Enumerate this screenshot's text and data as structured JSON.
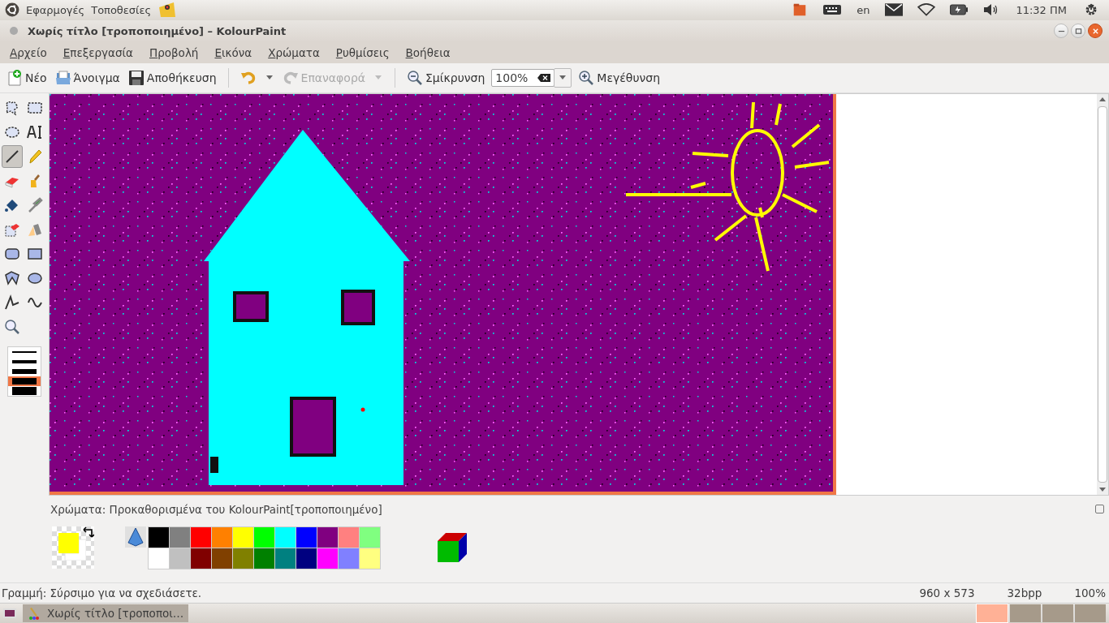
{
  "top_panel": {
    "menus": [
      "Εφαρμογές",
      "Τοποθεσίες"
    ],
    "indicators": [
      {
        "kind": "folder"
      },
      {
        "kind": "keyboard"
      },
      {
        "kind": "text",
        "label": "en"
      },
      {
        "kind": "mail"
      },
      {
        "kind": "wifi"
      },
      {
        "kind": "battery"
      },
      {
        "kind": "volume"
      },
      {
        "kind": "text",
        "label": "11:32 ΠΜ"
      },
      {
        "kind": "power"
      }
    ]
  },
  "window": {
    "title": "Χωρίς τίτλο [τροποποιημένο] – KolourPaint"
  },
  "menu_bar": [
    "Αρχείο",
    "Επεξεργασία",
    "Προβολή",
    "Εικόνα",
    "Χρώματα",
    "Ρυθμίσεις",
    "Βοήθεια"
  ],
  "toolbar": [
    {
      "kind": "new",
      "label": "Νέο",
      "disabled": false
    },
    {
      "kind": "open",
      "label": "Άνοιγμα",
      "disabled": false
    },
    {
      "kind": "save",
      "label": "Αποθήκευση",
      "disabled": false
    },
    {
      "kind": "separator"
    },
    {
      "kind": "undo",
      "disabled": false
    },
    {
      "kind": "redo",
      "label": "Επαναφορά",
      "disabled": true
    },
    {
      "kind": "separator"
    },
    {
      "kind": "zoom-out",
      "label": "Σμίκρυνση",
      "disabled": false
    },
    {
      "kind": "zoom-field",
      "value": "100%"
    },
    {
      "kind": "zoom-in",
      "label": "Μεγέθυνση",
      "disabled": false
    }
  ],
  "tools": [
    {
      "kind": "free-select",
      "selected": false
    },
    {
      "kind": "rect-select",
      "selected": false
    },
    {
      "kind": "ellipse-select",
      "selected": false
    },
    {
      "kind": "text",
      "selected": false
    },
    {
      "kind": "line",
      "selected": true
    },
    {
      "kind": "pen",
      "selected": false
    },
    {
      "kind": "eraser",
      "selected": false
    },
    {
      "kind": "brush",
      "selected": false
    },
    {
      "kind": "fill",
      "selected": false
    },
    {
      "kind": "picker",
      "selected": false
    },
    {
      "kind": "color-eraser",
      "selected": false
    },
    {
      "kind": "spraycan",
      "selected": false
    },
    {
      "kind": "rounded-rect",
      "selected": false
    },
    {
      "kind": "rect",
      "selected": false
    },
    {
      "kind": "polygon",
      "selected": false
    },
    {
      "kind": "ellipse",
      "selected": false
    },
    {
      "kind": "polyline",
      "selected": false
    },
    {
      "kind": "curve",
      "selected": false
    },
    {
      "kind": "zoom",
      "selected": false
    }
  ],
  "line_widths": [
    {
      "selected": false
    },
    {
      "selected": false
    },
    {
      "selected": false
    },
    {
      "selected": true
    },
    {
      "selected": false
    }
  ],
  "colors_panel": {
    "title": "Χρώματα: Προκαθορισμένα του KolourPaint[τροποποιημένο]",
    "current": [
      {
        "color": "#ffff00"
      },
      {
        "color": "#ffffff"
      }
    ],
    "palette": [
      {
        "color": "#000000"
      },
      {
        "color": "#808080"
      },
      {
        "color": "#ff0000"
      },
      {
        "color": "#ff8000"
      },
      {
        "color": "#ffff00"
      },
      {
        "color": "#00ff00"
      },
      {
        "color": "#00ffff"
      },
      {
        "color": "#0000ff"
      },
      {
        "color": "#800080"
      },
      {
        "color": "#ff8080"
      },
      {
        "color": "#80ff80"
      },
      {
        "color": "#ffffff"
      },
      {
        "color": "#c0c0c0"
      },
      {
        "color": "#800000"
      },
      {
        "color": "#804000"
      },
      {
        "color": "#808000"
      },
      {
        "color": "#008000"
      },
      {
        "color": "#008080"
      },
      {
        "color": "#000080"
      },
      {
        "color": "#ff00ff"
      },
      {
        "color": "#8080ff"
      },
      {
        "color": "#ffff80"
      }
    ]
  },
  "status_bar": {
    "message": "Γραμμή: Σύρσιμο για να σχεδιάσετε.",
    "size": "960 x 573",
    "depth": "32bpp",
    "zoom": "100%"
  },
  "taskbar": {
    "task": "Χωρίς τίτλο [τροποποι…",
    "workspaces": [
      {
        "selected": true
      },
      {
        "selected": false
      },
      {
        "selected": false
      },
      {
        "selected": false
      }
    ]
  }
}
